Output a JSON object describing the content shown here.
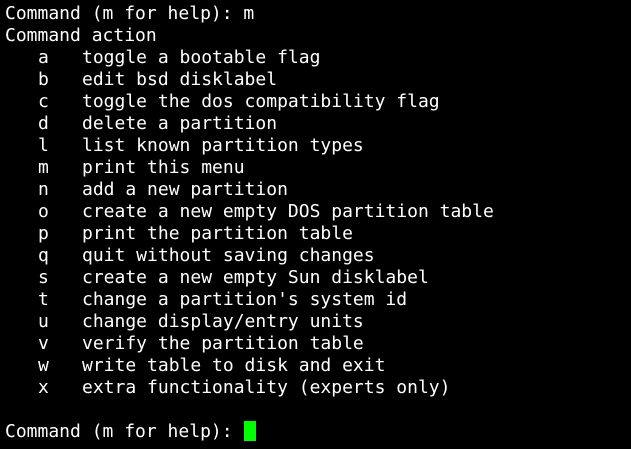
{
  "terminal": {
    "first_prompt": "Command (m for help): m",
    "header": "Command action",
    "menu": [
      {
        "key": "a",
        "desc": "toggle a bootable flag"
      },
      {
        "key": "b",
        "desc": "edit bsd disklabel"
      },
      {
        "key": "c",
        "desc": "toggle the dos compatibility flag"
      },
      {
        "key": "d",
        "desc": "delete a partition"
      },
      {
        "key": "l",
        "desc": "list known partition types"
      },
      {
        "key": "m",
        "desc": "print this menu"
      },
      {
        "key": "n",
        "desc": "add a new partition"
      },
      {
        "key": "o",
        "desc": "create a new empty DOS partition table"
      },
      {
        "key": "p",
        "desc": "print the partition table"
      },
      {
        "key": "q",
        "desc": "quit without saving changes"
      },
      {
        "key": "s",
        "desc": "create a new empty Sun disklabel"
      },
      {
        "key": "t",
        "desc": "change a partition's system id"
      },
      {
        "key": "u",
        "desc": "change display/entry units"
      },
      {
        "key": "v",
        "desc": "verify the partition table"
      },
      {
        "key": "w",
        "desc": "write table to disk and exit"
      },
      {
        "key": "x",
        "desc": "extra functionality (experts only)"
      }
    ],
    "final_prompt": "Command (m for help): ",
    "colors": {
      "background": "#000000",
      "text": "#ffffff",
      "cursor": "#00ff00"
    }
  }
}
